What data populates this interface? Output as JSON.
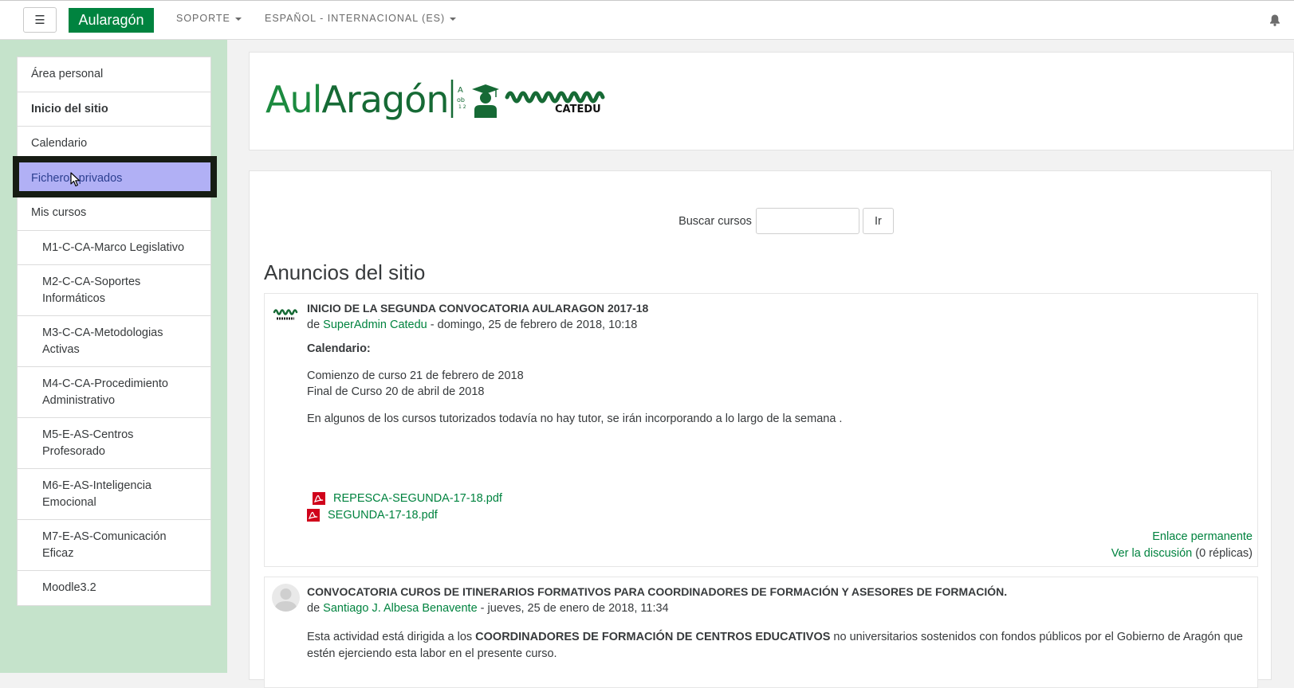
{
  "navbar": {
    "menu_toggle": "☰",
    "brand": "Aularagón",
    "menus": [
      "SOPORTE",
      "ESPAÑOL - INTERNACIONAL (ES)"
    ],
    "icons": [
      "hamburger-icon",
      "caret-down-icon",
      "notification-bell-icon"
    ]
  },
  "drawer": {
    "items": [
      {
        "label": "Área personal"
      },
      {
        "label": "Inicio del sitio"
      },
      {
        "label": "Calendario"
      },
      {
        "label": "Ficheros privados"
      },
      {
        "label": "Mis cursos"
      },
      {
        "label": "M1-C-CA-Marco Legislativo"
      },
      {
        "label": "M2-C-CA-Soportes Informáticos"
      },
      {
        "label": "M3-C-CA-Metodologias Activas"
      },
      {
        "label": "M4-C-CA-Procedimiento Administrativo"
      },
      {
        "label": "M5-E-AS-Centros Profesorado"
      },
      {
        "label": "M6-E-AS-Inteligencia Emocional"
      },
      {
        "label": "M7-E-AS-Comunicación Eficaz"
      },
      {
        "label": "Moodle3.2"
      }
    ],
    "active_item": "Ficheros privados",
    "accent_color": "#c5e3cb",
    "active_color": "#b1b0f5"
  },
  "logo": {
    "text_part1": "Aul",
    "text_part2": "Aragón",
    "badge": "CATEDU"
  },
  "search": {
    "label": "Buscar cursos",
    "value": "",
    "button": "Ir"
  },
  "section_title": "Anuncios del sitio",
  "posts": [
    {
      "subject": "INICIO DE LA SEGUNDA CONVOCATORIA AULARAGON 2017-18",
      "by_prefix": "de ",
      "author": "SuperAdmin Catedu",
      "date": " - domingo, 25 de febrero de 2018, 10:18",
      "heading": "Calendario:",
      "line1": "Comienzo de curso 21 de febrero de 2018",
      "line2": "Final de Curso 20 de abril de 2018",
      "line3": "En algunos de los cursos tutorizados todavía no hay tutor, se irán incorporando a lo largo de la semana .",
      "attachments": [
        "REPESCA-SEGUNDA-17-18.pdf",
        "SEGUNDA-17-18.pdf"
      ],
      "permalink": "Enlace permanente",
      "discussion": "Ver la discusión",
      "replies": " (0 réplicas)"
    },
    {
      "subject": "CONVOCATORIA CUROS DE ITINERARIOS FORMATIVOS PARA COORDINADORES DE FORMACIÓN Y ASESORES DE FORMACIÓN.",
      "by_prefix": "de ",
      "author": "Santiago J. Albesa Benavente",
      "date": " - jueves, 25 de enero de 2018, 11:34",
      "text_before": "Esta actividad está dirigida a los ",
      "text_bold": "COORDINADORES DE FORMACIÓN DE CENTROS EDUCATIVOS",
      "text_after": " no universitarios sostenidos con fondos públicos por el Gobierno de Aragón que estén ejerciendo esta labor en el presente curso."
    }
  ],
  "colors": {
    "brand": "#00833f",
    "link": "#00833f"
  }
}
